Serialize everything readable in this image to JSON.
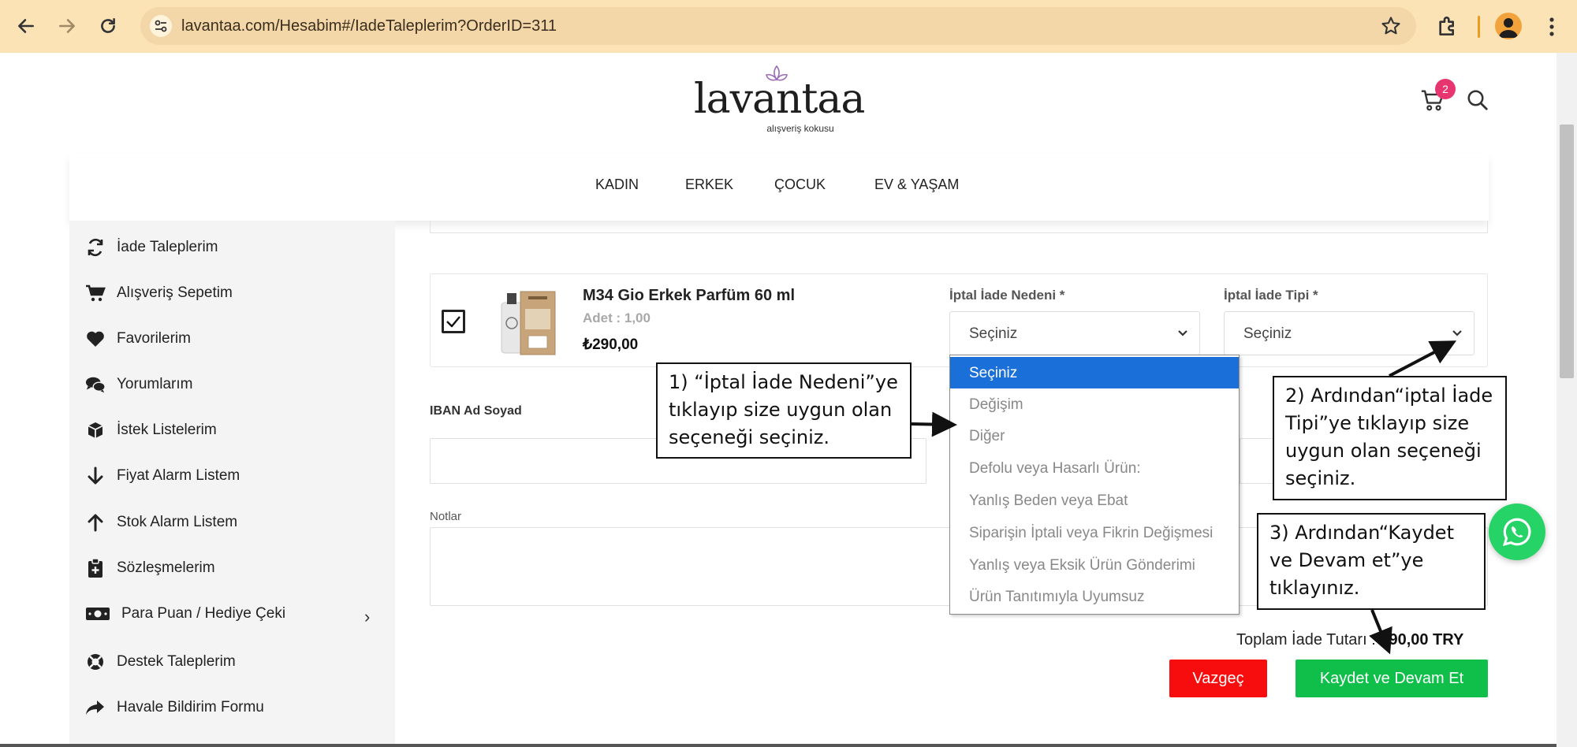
{
  "browser": {
    "url": "lavantaa.com/Hesabim#/IadeTaleplerim?OrderID=311",
    "icons": [
      "back-icon",
      "forward-icon",
      "reload-icon",
      "site-settings-icon",
      "bookmark-star-icon",
      "extensions-icon",
      "profile-icon",
      "menu-icon"
    ]
  },
  "header": {
    "logo_text": "lavantaa",
    "logo_tagline": "alışveriş kokusu",
    "cart_count": "2"
  },
  "nav": {
    "items": [
      "KADIN",
      "ERKEK",
      "ÇOCUK",
      "EV & YAŞAM"
    ]
  },
  "sidebar": {
    "items": [
      {
        "label": "İade Taleplerim",
        "icon": "refresh-icon"
      },
      {
        "label": "Alışveriş Sepetim",
        "icon": "cart-icon"
      },
      {
        "label": "Favorilerim",
        "icon": "heart-icon"
      },
      {
        "label": "Yorumlarım",
        "icon": "comments-icon"
      },
      {
        "label": "İstek Listelerim",
        "icon": "box-icon"
      },
      {
        "label": "Fiyat Alarm Listem",
        "icon": "arrow-down-icon"
      },
      {
        "label": "Stok Alarm Listem",
        "icon": "arrow-up-icon"
      },
      {
        "label": "Sözleşmelerim",
        "icon": "clipboard-icon"
      },
      {
        "label": "Para Puan / Hediye Çeki",
        "icon": "money-icon"
      },
      {
        "label": "Destek Taleplerim",
        "icon": "lifebuoy-icon"
      },
      {
        "label": "Havale Bildirim Formu",
        "icon": "share-icon"
      }
    ],
    "submenu_arrow": "›"
  },
  "product": {
    "name": "M34 Gio Erkek Parfüm 60 ml",
    "qty": "Adet : 1,00",
    "price": "₺290,00",
    "checked": true
  },
  "form": {
    "reason_label": "İptal İade Nedeni *",
    "reason_value": "Seçiniz",
    "type_label": "İptal İade Tipi *",
    "type_value": "Seçiniz",
    "reason_options": [
      "Seçiniz",
      "Değişim",
      "Diğer",
      "Defolu veya Hasarlı Ürün:",
      "Yanlış Beden veya Ebat",
      "Siparişin İptali veya Fikrin Değişmesi",
      "Yanlış veya Eksik Ürün Gönderimi",
      "Ürün Tanıtımıyla Uyumsuz"
    ],
    "selected_option": "Seçiniz",
    "iban_label": "IBAN Ad Soyad",
    "notes_label": "Notlar",
    "total_label": "Toplam İade Tutarı :",
    "total_value": "290,00 TRY",
    "cancel_label": "Vazgeç",
    "save_label": "Kaydet ve Devam Et"
  },
  "annotations": {
    "step1": [
      "1) “İptal İade Nedeni”ye",
      "tıklayıp size uygun olan",
      "seçeneği seçiniz."
    ],
    "step2": [
      "2) Ardından“iptal İade",
      "Tipi”ye tıklayıp size",
      "uygun olan seçeneği",
      "seçiniz."
    ],
    "step3": [
      "3) Ardından“Kaydet",
      "ve Devam et”ye",
      "tıklayınız."
    ]
  },
  "colors": {
    "chrome_bg": "#fbe3b6",
    "select_highlight": "#1a6fd8",
    "cancel_button": "#f70d0d",
    "save_button": "#0fbf4a",
    "cart_badge": "#e6356f",
    "whatsapp": "#25d366"
  }
}
